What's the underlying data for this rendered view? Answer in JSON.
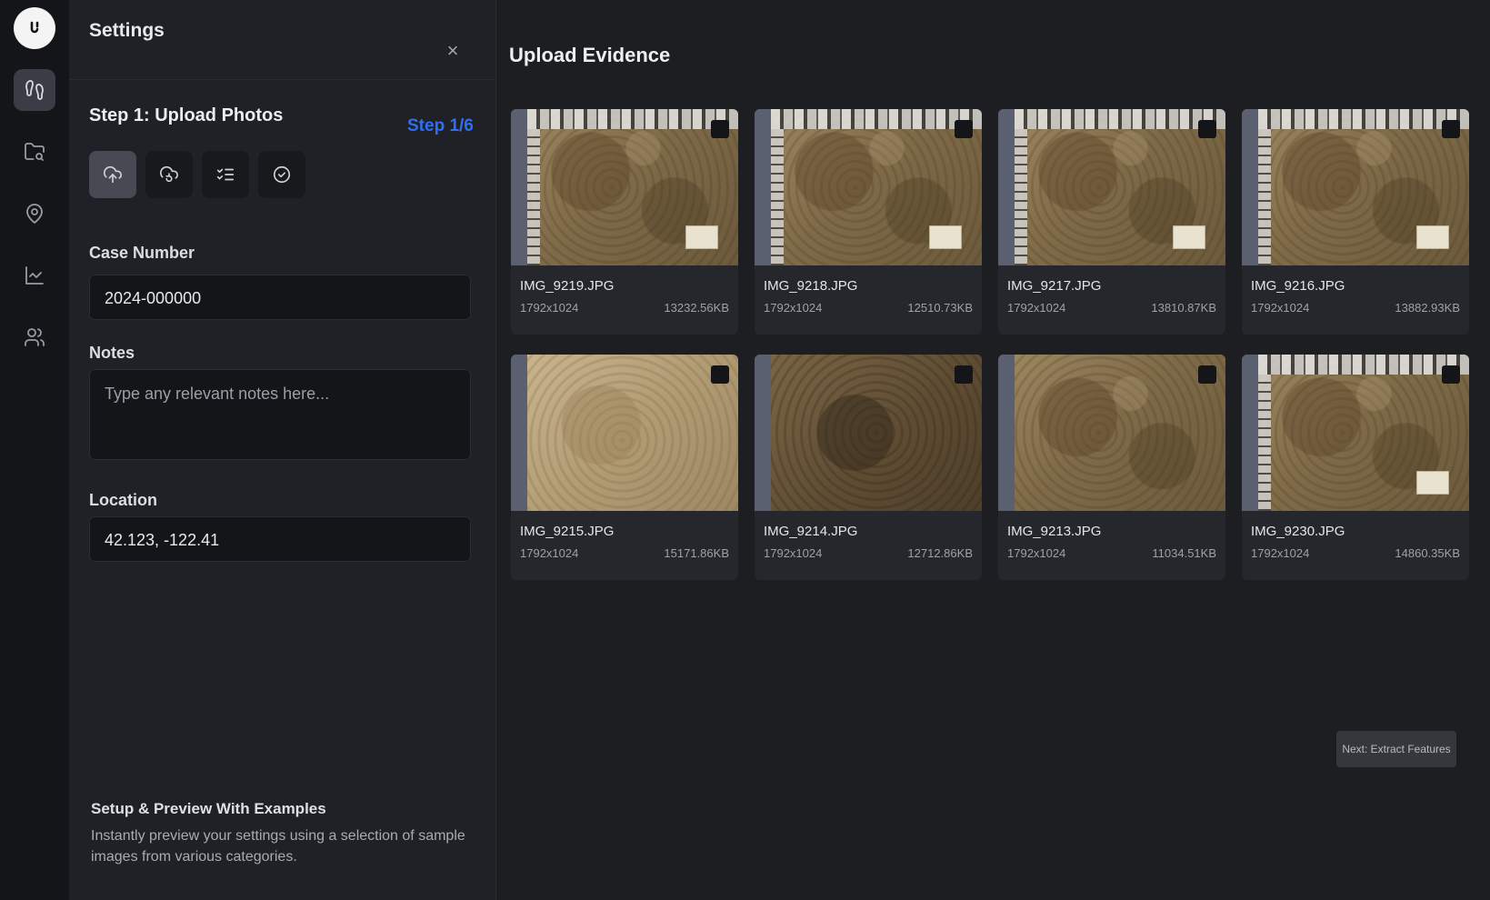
{
  "rail": {
    "items": [
      {
        "name": "footprints",
        "active": true
      },
      {
        "name": "folder-search",
        "active": false
      },
      {
        "name": "map-pin",
        "active": false
      },
      {
        "name": "line-chart",
        "active": false
      },
      {
        "name": "users",
        "active": false
      }
    ]
  },
  "settings": {
    "title": "Settings",
    "close_glyph": "×",
    "step_title": "Step 1: Upload Photos",
    "step_count": "Step 1/6",
    "step_icons": [
      "upload-cloud-icon",
      "refresh-cloud-icon",
      "list-checks-icon",
      "check-circle-icon"
    ],
    "case_number_label": "Case Number",
    "case_number_value": "2024-000000",
    "notes_label": "Notes",
    "notes_placeholder": "Type any relevant notes here...",
    "location_label": "Location",
    "location_value": "42.123, -122.41",
    "preview_title": "Setup & Preview With Examples",
    "preview_text": "Instantly preview your settings using a selection of sample images from various categories."
  },
  "main": {
    "title": "Upload Evidence",
    "next_button": "Next: Extract Features",
    "images": [
      {
        "name": "IMG_9219.JPG",
        "dims": "1792x1024",
        "size": "13232.56KB"
      },
      {
        "name": "IMG_9218.JPG",
        "dims": "1792x1024",
        "size": "12510.73KB"
      },
      {
        "name": "IMG_9217.JPG",
        "dims": "1792x1024",
        "size": "13810.87KB"
      },
      {
        "name": "IMG_9216.JPG",
        "dims": "1792x1024",
        "size": "13882.93KB"
      },
      {
        "name": "IMG_9215.JPG",
        "dims": "1792x1024",
        "size": "15171.86KB"
      },
      {
        "name": "IMG_9214.JPG",
        "dims": "1792x1024",
        "size": "12712.86KB"
      },
      {
        "name": "IMG_9213.JPG",
        "dims": "1792x1024",
        "size": "11034.51KB"
      },
      {
        "name": "IMG_9230.JPG",
        "dims": "1792x1024",
        "size": "14860.35KB"
      }
    ]
  },
  "colors": {
    "accent": "#2f6ff0",
    "background": "#1c1d21",
    "panel": "#202126",
    "rail": "#141518"
  }
}
